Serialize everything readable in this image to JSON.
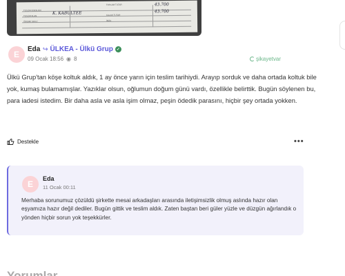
{
  "document_image": {
    "labels": [
      "TESLİM EDEN ADI",
      "TESLİM ALAN",
      "ÖDEME ŞEKLİ",
      "TOPLAM TUTAR",
      "KALAN TUTAR",
      "İMZA"
    ],
    "handwriting": [
      "K. KABULTEE",
      "43.700",
      "43.700"
    ]
  },
  "post": {
    "author": "Eda",
    "avatar_letter": "E",
    "brand": "ÜLKEA - Ülkü Grup",
    "date": "09 Ocak 18:56",
    "views": "8",
    "source_logo": "şikayetvar",
    "text": "Ülkü Grup'tan köşe koltuk aldık, 1 ay önce yarın için teslim tarihiydi. Arayıp sorduk ve daha ortada koltuk bile yok, kumaş bulamamışlar. Yazıklar olsun, oğlumun doğum günü vardı, özellikle belirttik. Bugün söylenen bu, para iadesi istedim. Bir daha asla ve asla işim olmaz, peşin ödedik parasını, hiçbir şey ortada yokken.",
    "support_label": "Destekle",
    "more_label": "•••"
  },
  "reply": {
    "author": "Eda",
    "avatar_letter": "E",
    "time": "11 Ocak 00:11",
    "text": "Merhaba sorunumuz çözüldü şirkette mesai arkadaşları arasında iletişimsizlik olmuş aslında hazır olan eşyamıza hazır değil dediler. Bugün gittik ve teslim aldık. Zaten baştan beri güler yüzle ve düzgün ağırlandık o yönden hiçbir sorun yok teşekkürler."
  },
  "comments": {
    "title": "Yorumlar"
  },
  "colors": {
    "brand": "#5a57d9",
    "avatar_bg": "#fbd3d6",
    "reply_bg": "#f2f1fb",
    "verified": "#3b8f5a",
    "logo_green": "#6bb78a"
  }
}
